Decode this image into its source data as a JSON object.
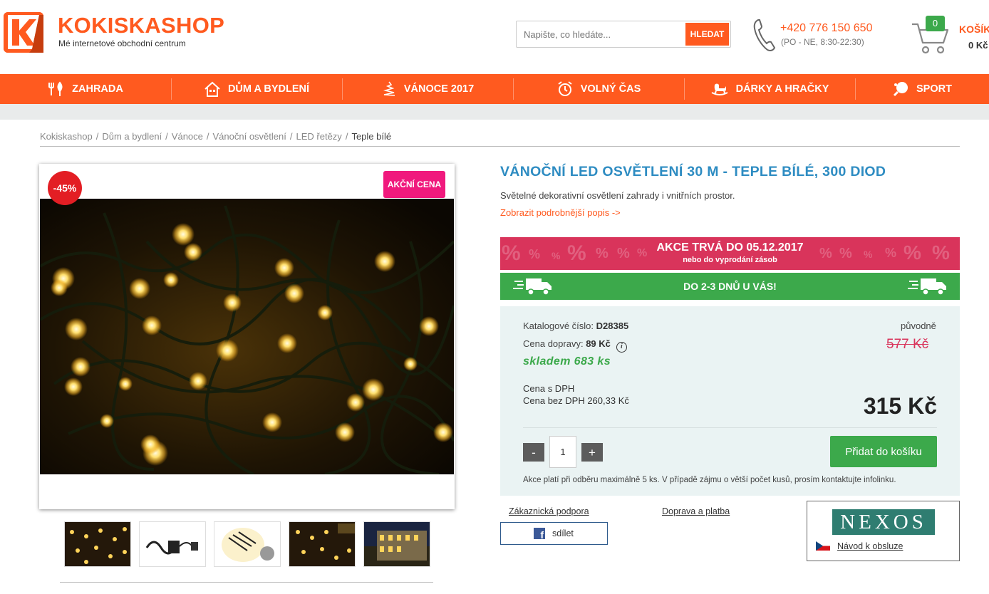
{
  "header": {
    "logo_text": "KOKISKASHOP",
    "logo_tagline": "Mé internetové obchodní centrum",
    "search_placeholder": "Napište, co hledáte...",
    "search_button": "HLEDAT",
    "phone_number": "+420 776 150 650",
    "phone_hours": "(PO - NE, 8:30-22:30)",
    "cart_count": "0",
    "cart_label": "KOŠÍK",
    "cart_total": "0 Kč"
  },
  "nav": {
    "items": [
      {
        "label": "ZAHRADA",
        "icon": "garden-tools-icon"
      },
      {
        "label": "DŮM A BYDLENÍ",
        "icon": "house-icon"
      },
      {
        "label": "VÁNOCE 2017",
        "icon": "christmas-tree-icon"
      },
      {
        "label": "VOLNÝ ČAS",
        "icon": "alarm-clock-icon"
      },
      {
        "label": "DÁRKY A HRAČKY",
        "icon": "rocking-horse-icon"
      },
      {
        "label": "SPORT",
        "icon": "ping-pong-icon"
      }
    ]
  },
  "breadcrumb": {
    "items": [
      "Kokiskashop",
      "Dům a bydlení",
      "Vánoce",
      "Vánoční osvětlení",
      "LED řetězy"
    ],
    "current": "Teple bílé",
    "separator": "/"
  },
  "product": {
    "discount_badge": "-45%",
    "sale_badge": "AKČNÍ CENA",
    "title": "VÁNOČNÍ LED OSVĚTLENÍ 30 M - TEPLE BÍLÉ, 300 DIOD",
    "description": "Světelné dekorativní osvětlení zahrady i vnitřních prostor.",
    "more_link": "Zobrazit podrobnější popis ->",
    "promo_title": "AKCE TRVÁ DO 05.12.2017",
    "promo_subtitle": "nebo do vyprodání zásob",
    "delivery_text": "DO 2-3 DNŮ U VÁS!",
    "catalog_label": "Katalogové číslo:",
    "catalog_number": "D28385",
    "shipping_label": "Cena dopravy:",
    "shipping_price": "89 Kč",
    "stock": "skladem 683 ks",
    "original_label": "původně",
    "original_price": "577 Kč",
    "price_with_vat_label": "Cena s DPH",
    "price_without_vat": "Cena bez DPH 260,33 Kč",
    "price": "315 Kč",
    "quantity": "1",
    "minus_label": "-",
    "plus_label": "+",
    "add_to_cart": "Přidat do košíku",
    "note": "Akce platí při odběru maximálně 5 ks. V případě zájmu o větší počet kusů, prosím kontaktujte infolinku."
  },
  "links": {
    "support": "Zákaznická podpora",
    "shipping": "Doprava a platba",
    "share": "sdílet",
    "brand": "NEXOS",
    "manual": "Návod k obsluze"
  },
  "colors": {
    "brand_orange": "#ff5a1f",
    "title_blue": "#2e8cc2",
    "promo_red": "#d9345b",
    "green": "#3ca94b",
    "sale_pink": "#f0197d",
    "discount_red": "#e31e24"
  }
}
